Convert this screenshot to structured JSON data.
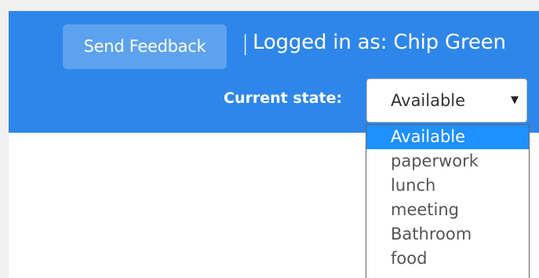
{
  "header": {
    "feedback_label": "Send Feedback",
    "separator": "|",
    "logged_in_text": "Logged in as: Chip Green",
    "state_label": "Current state:"
  },
  "state_select": {
    "selected": "Available",
    "arrow_icon": "triangle-down",
    "options": [
      "Available",
      "paperwork",
      "lunch",
      "meeting",
      "Bathroom",
      "food"
    ]
  },
  "colors": {
    "header_bg": "#2f86ea",
    "button_bg": "#5da2ef",
    "option_highlight": "#1e90ff"
  }
}
